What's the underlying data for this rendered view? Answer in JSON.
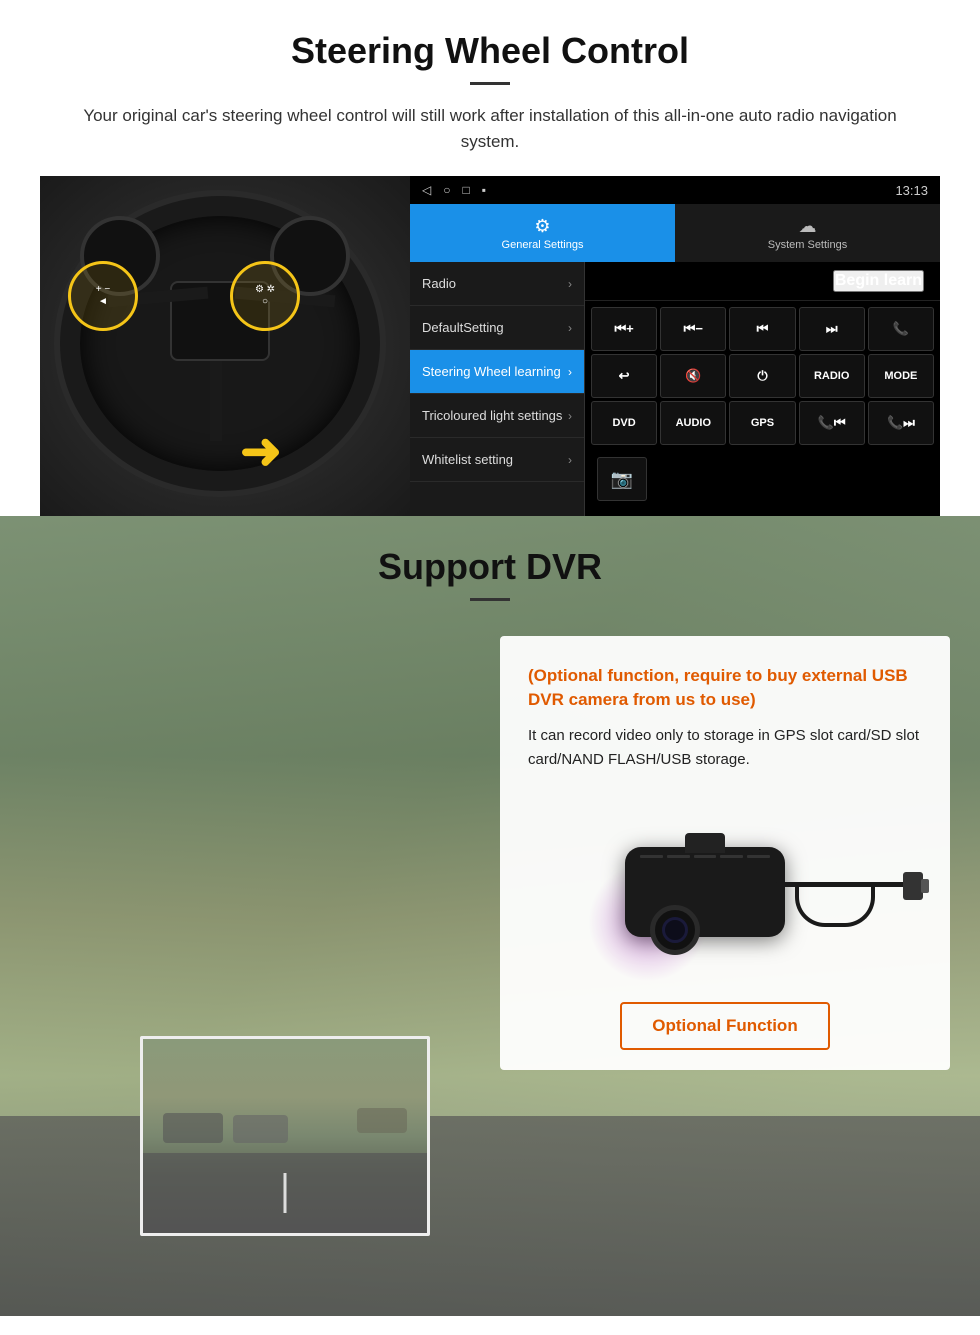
{
  "section1": {
    "title": "Steering Wheel Control",
    "subtitle": "Your original car's steering wheel control will still work after installation of this all-in-one auto radio navigation system.",
    "android": {
      "statusbar": {
        "time": "13:13",
        "icons_left": [
          "◁",
          "○",
          "□",
          "▪"
        ]
      },
      "tabs": [
        {
          "label": "General Settings",
          "icon": "⚙",
          "active": true
        },
        {
          "label": "System Settings",
          "icon": "☁",
          "active": false
        }
      ],
      "menu_items": [
        {
          "label": "Radio",
          "active": false
        },
        {
          "label": "DefaultSetting",
          "active": false
        },
        {
          "label": "Steering Wheel learning",
          "active": true
        },
        {
          "label": "Tricoloured light settings",
          "active": false
        },
        {
          "label": "Whitelist setting",
          "active": false
        }
      ],
      "begin_learn": "Begin learn",
      "control_buttons": [
        "⏮+",
        "⏮−",
        "⏮⏮",
        "⏭⏭",
        "📞",
        "↩",
        "🔇x",
        "⏻",
        "RADIO",
        "MODE",
        "DVD",
        "AUDIO",
        "GPS",
        "📞⏮",
        "📞⏭",
        "📷"
      ]
    }
  },
  "section2": {
    "title": "Support DVR",
    "info_card": {
      "optional_text": "(Optional function, require to buy external USB DVR camera from us to use)",
      "desc_text": "It can record video only to storage in GPS slot card/SD slot card/NAND FLASH/USB storage."
    },
    "optional_function_btn": "Optional Function"
  }
}
